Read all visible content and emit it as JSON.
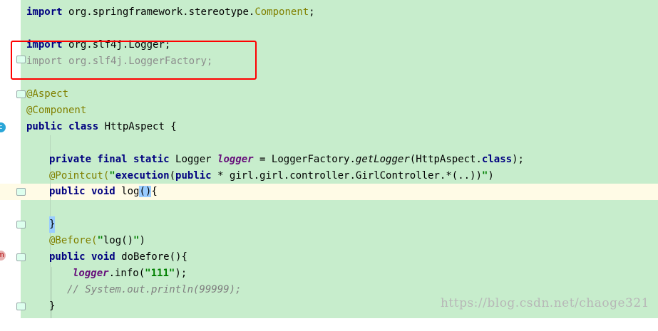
{
  "code": {
    "import_component": {
      "kw": "import",
      "pkg": "org.springframework.stereotype.",
      "cls": "Component",
      "semi": ";"
    },
    "import_logger": {
      "kw": "import",
      "rest": "org.slf4j.Logger;"
    },
    "import_logger_factory": {
      "kw": "import",
      "rest": "org.slf4j.LoggerFactory;"
    },
    "ann_aspect": "@Aspect",
    "ann_component": "@Component",
    "class_decl": {
      "kw": "public class",
      "rest": "HttpAspect {"
    },
    "logger_field": {
      "kw": "private final static",
      "type": "Logger",
      "name": "logger",
      "eq": "= LoggerFactory.",
      "method": "getLogger",
      "args": "(HttpAspect.",
      "kw2": "class",
      "end": ");"
    },
    "pointcut": {
      "ann": "@Pointcut(",
      "q1": "\"",
      "exec": "execution",
      "paren": "(",
      "kw": "public",
      "rest": "* girl.girl.controller.GirlController.*(..))",
      "q2": "\"",
      "end": ")"
    },
    "log_method": {
      "kw": "public void",
      "name": "log",
      "paren": "()",
      "brace": "{"
    },
    "close_brace_1": "}",
    "before": {
      "ann": "@Before(",
      "q1": "\"",
      "val": "log()",
      "q2": "\"",
      "end": ")"
    },
    "dobefore": {
      "kw": "public void",
      "rest": "doBefore(){"
    },
    "logger_info": {
      "field": "logger",
      "rest": ".info(",
      "str": "\"111\"",
      "end": ");"
    },
    "comment": "// System.out.println(99999);",
    "close_brace_2": "}"
  },
  "gutter_icons": {
    "class_icon": "c",
    "method_icon": "m"
  },
  "watermark": "https://blog.csdn.net/chaoge321",
  "colors": {
    "editor_bg": "#c7edcc",
    "current_line": "#fffbe6",
    "highlight_box": "#ff0000",
    "keyword": "#000080",
    "annotation": "#808000",
    "string": "#008000"
  }
}
